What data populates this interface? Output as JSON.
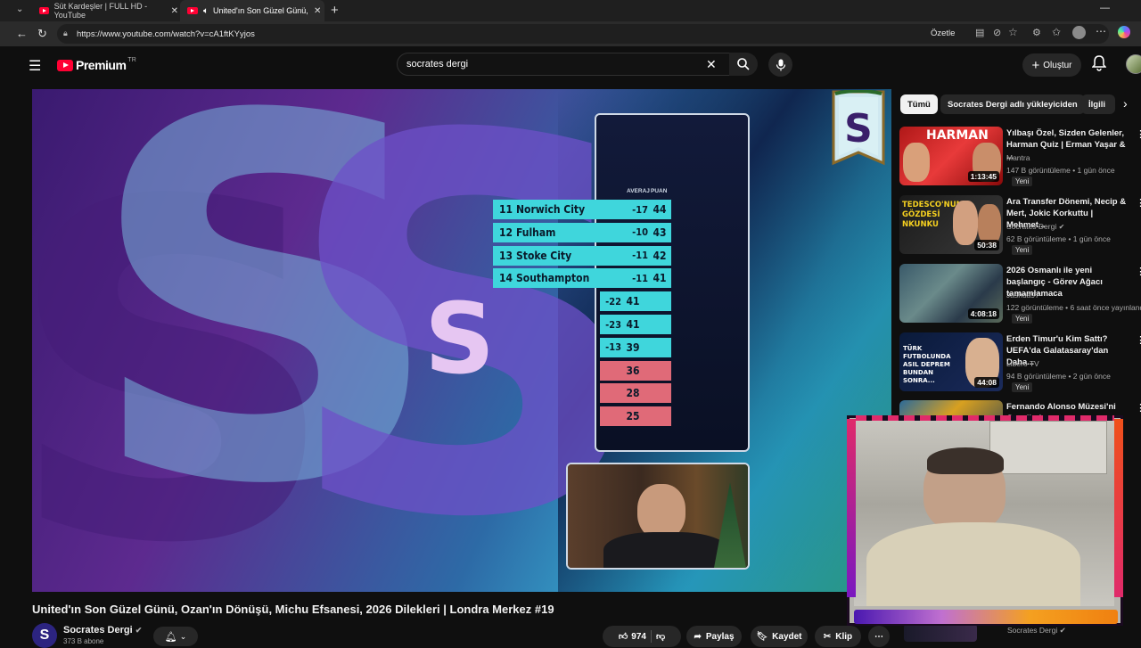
{
  "browser": {
    "tabs": [
      {
        "title": "Süt Kardeşler | FULL HD - YouTube"
      },
      {
        "title": "United'ın Son Güzel Günü, Oz"
      }
    ],
    "url": "https://www.youtube.com/watch?v=cA1ftKYyjos",
    "summarize_label": "Özetle"
  },
  "header": {
    "logo_text": "Premium",
    "logo_region": "TR",
    "search_value": "socrates dergi",
    "create_label": "Oluştur"
  },
  "video": {
    "title": "United'ın Son Güzel Günü, Ozan'ın Dönüşü, Michu Efsanesi, 2026 Dilekleri | Londra Merkez #19",
    "table_headers": {
      "avg": "AVERAJ",
      "pts": "PUAN"
    },
    "table_rows": [
      {
        "pos": "11",
        "team": "Norwich City",
        "avg": "-17",
        "pts": "44"
      },
      {
        "pos": "12",
        "team": "Fulham",
        "avg": "-10",
        "pts": "43"
      },
      {
        "pos": "13",
        "team": "Stoke City",
        "avg": "-11",
        "pts": "42"
      },
      {
        "pos": "14",
        "team": "Southampton",
        "avg": "-11",
        "pts": "41"
      },
      {
        "pos": "",
        "team": "",
        "avg": "-22",
        "pts": "41"
      },
      {
        "pos": "",
        "team": "",
        "avg": "-23",
        "pts": "41"
      },
      {
        "pos": "",
        "team": "",
        "avg": "-13",
        "pts": "39"
      },
      {
        "pos": "",
        "team": "",
        "avg": "",
        "pts": "36"
      },
      {
        "pos": "",
        "team": "",
        "avg": "",
        "pts": "28"
      },
      {
        "pos": "",
        "team": "",
        "avg": "",
        "pts": "25"
      }
    ]
  },
  "channel": {
    "name": "Socrates Dergi",
    "subscribers": "373 B abone",
    "avatar_letter": "S"
  },
  "actions": {
    "likes": "974",
    "share": "Paylaş",
    "save": "Kaydet",
    "clip": "Klip"
  },
  "chips": [
    "Tümü",
    "Socrates Dergi adlı yükleyiciden",
    "İlgili"
  ],
  "recommendations": [
    {
      "title": "Yılbaşı Özel, Sizden Gelenler, Harman Quiz | Erman Yaşar & ...",
      "channel": "Mantra",
      "meta": "147 B görüntüleme • 1 gün önce",
      "badge": "Yeni",
      "duration": "1:13:45"
    },
    {
      "title": "Ara Transfer Dönemi, Necip & Mert, Jokic Korkuttu | Mehmet...",
      "channel": "Socrates Dergi",
      "meta": "62 B görüntüleme • 1 gün önce",
      "badge": "Yeni",
      "duration": "50:38"
    },
    {
      "title": "2026 Osmanlı ile yeni başlangıç - Görev Ağacı tamamlamaca",
      "channel": "Jashua97",
      "meta": "122 görüntüleme • 6 saat önce yayınlandı",
      "badge": "Yeni",
      "duration": "4:08:18"
    },
    {
      "title": "Erden Timur'u Kim Sattı? UEFA'da Galatasaray'dan Daha...",
      "channel": "Libero TV",
      "meta": "94 B görüntüleme • 2 gün önce",
      "badge": "Yeni",
      "duration": "44:08"
    },
    {
      "title": "Fernando Alonso Müzesi'ni Gezelim!",
      "channel": "",
      "meta": "",
      "badge": "",
      "duration": ""
    }
  ],
  "thumb_texts": {
    "harman": "HARMAN",
    "tedesco": "TEDESCO'NUN GÖZDESİ NKUNKU",
    "turk": "TÜRK FUTBOLUNDA ASIL DEPREM BUNDAN SONRA..."
  },
  "bottom_rec": {
    "channel": "Socrates Dergi"
  },
  "colors": {
    "yt_red": "#ff0033",
    "bg": "#0f0f0f",
    "table_cyan": "#3fd6dc",
    "table_red": "#e06a78"
  }
}
